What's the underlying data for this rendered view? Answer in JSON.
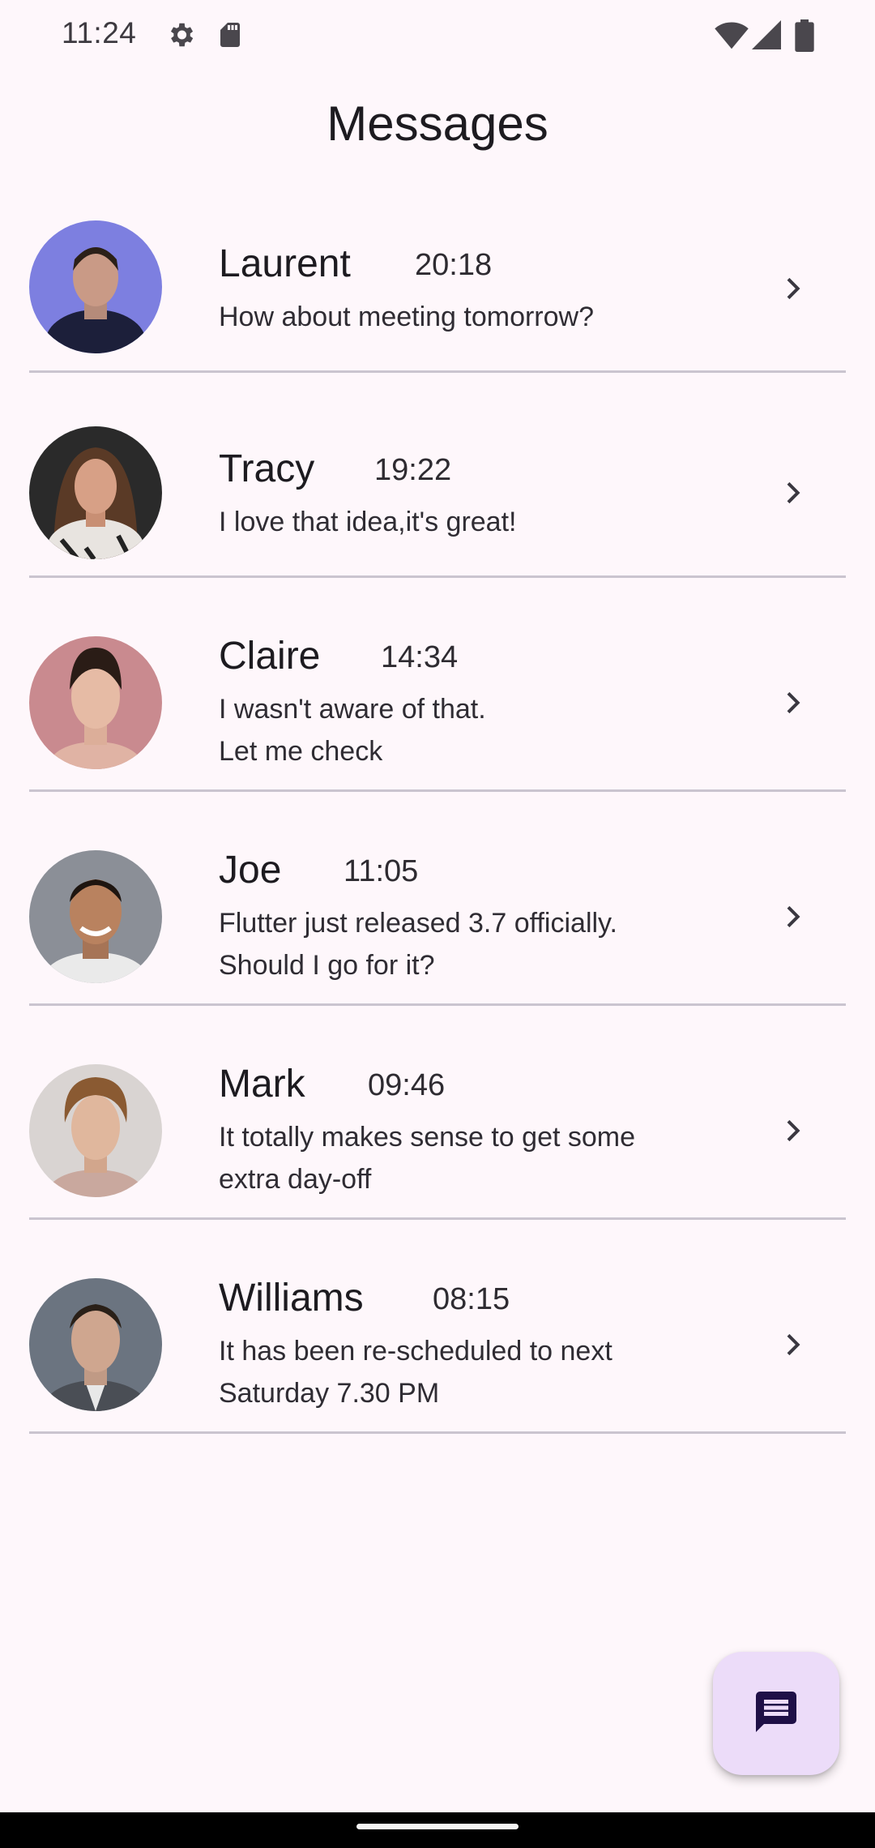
{
  "status_bar": {
    "time": "11:24",
    "icons": [
      "gear-icon",
      "sd-card-icon",
      "wifi-icon",
      "signal-icon",
      "battery-icon"
    ]
  },
  "header": {
    "title": "Messages"
  },
  "conversations": [
    {
      "name": "Laurent",
      "time": "20:18",
      "preview": "How about meeting tomorrow?",
      "avatar_bg": "#7d7fe0"
    },
    {
      "name": "Tracy",
      "time": "19:22",
      "preview": "I love that idea,it's great!",
      "avatar_bg": "#2a2a2a"
    },
    {
      "name": "Claire",
      "time": "14:34",
      "preview": "I wasn't aware of that.\nLet me check",
      "avatar_bg": "#c98a8f"
    },
    {
      "name": "Joe",
      "time": "11:05",
      "preview": "Flutter just released 3.7 officially.\nShould I go for it?",
      "avatar_bg": "#8b8f97"
    },
    {
      "name": "Mark",
      "time": "09:46",
      "preview": "It totally makes sense to get some\nextra day-off",
      "avatar_bg": "#d9d4d2"
    },
    {
      "name": "Williams",
      "time": "08:15",
      "preview": "It has been re-scheduled to next\nSaturday 7.30 PM",
      "avatar_bg": "#6b7480"
    }
  ],
  "fab": {
    "icon": "message-icon",
    "color": "#ecdcf9"
  },
  "colors": {
    "background": "#fef7fb",
    "divider": "#cac4cf",
    "fab_icon": "#1f1047"
  }
}
